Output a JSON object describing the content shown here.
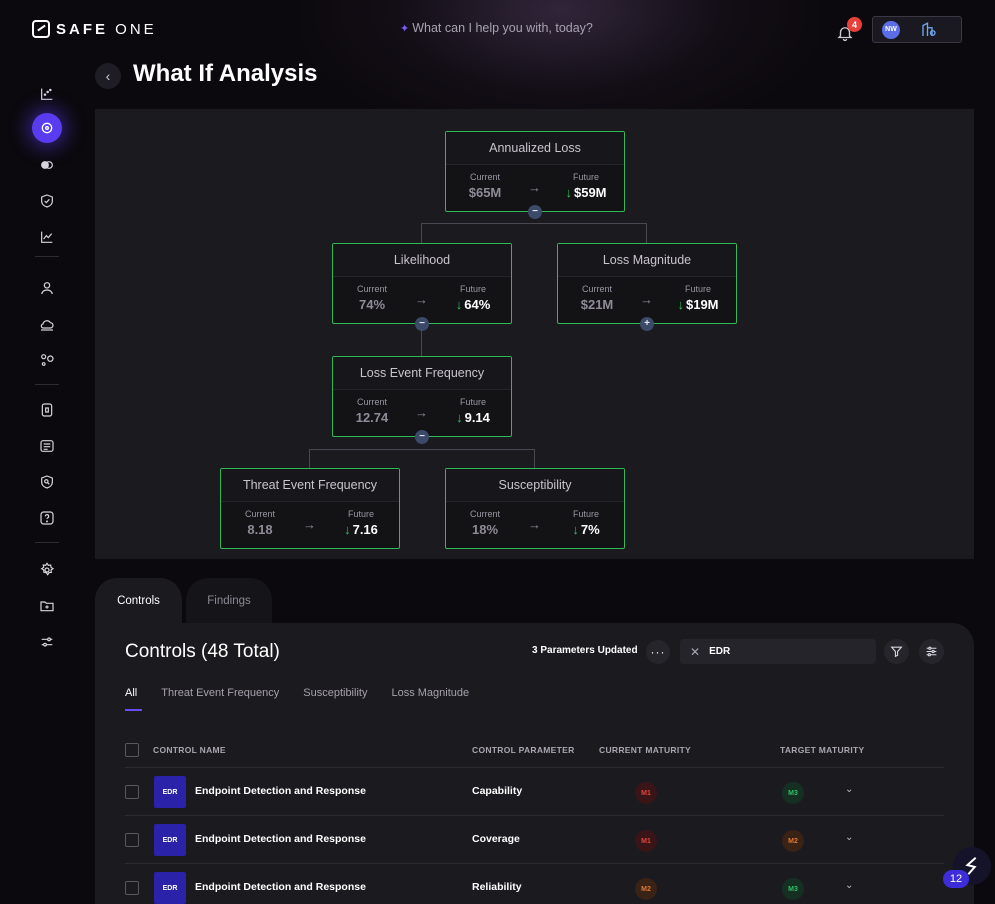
{
  "brand": {
    "name_bold": "SAFE",
    "name_light": " ONE"
  },
  "header": {
    "ai_prompt": "What can I help you with, today?",
    "notification_count": "4",
    "user_initials": "NW"
  },
  "page": {
    "title": "What If Analysis"
  },
  "tree": {
    "current_label": "Current",
    "future_label": "Future",
    "nodes": [
      {
        "title": "Annualized Loss",
        "current": "$65M",
        "future": "$59M",
        "toggle": "−"
      },
      {
        "title": "Likelihood",
        "current": "74%",
        "future": "64%",
        "toggle": "−"
      },
      {
        "title": "Loss Magnitude",
        "current": "$21M",
        "future": "$19M",
        "toggle": "+"
      },
      {
        "title": "Loss Event Frequency",
        "current": "12.74",
        "future": "9.14",
        "toggle": "−"
      },
      {
        "title": "Threat Event Frequency",
        "current": "8.18",
        "future": "7.16"
      },
      {
        "title": "Susceptibility",
        "current": "18%",
        "future": "7%"
      }
    ]
  },
  "tabs": [
    {
      "label": "Controls"
    },
    {
      "label": "Findings"
    }
  ],
  "controls": {
    "title": "Controls (48 Total)",
    "params_updated": "3 Parameters Updated",
    "search_value": "EDR",
    "filter_tabs": [
      "All",
      "Threat Event Frequency",
      "Susceptibility",
      "Loss Magnitude"
    ],
    "columns": [
      "CONTROL NAME",
      "CONTROL PARAMETER",
      "CURRENT MATURITY",
      "TARGET MATURITY"
    ],
    "rows": [
      {
        "badge": "EDR",
        "name": "Endpoint Detection and Response",
        "parameter": "Capability",
        "current": "M1",
        "target": "M3"
      },
      {
        "badge": "EDR",
        "name": "Endpoint Detection and Response",
        "parameter": "Coverage",
        "current": "M1",
        "target": "M2"
      },
      {
        "badge": "EDR",
        "name": "Endpoint Detection and Response",
        "parameter": "Reliability",
        "current": "M2",
        "target": "M3"
      }
    ]
  },
  "assistant": {
    "badge_count": "12"
  },
  "colors": {
    "accent": "#5a3cf0",
    "node_border": "#2fb75a",
    "down_green": "#2fc25e"
  }
}
